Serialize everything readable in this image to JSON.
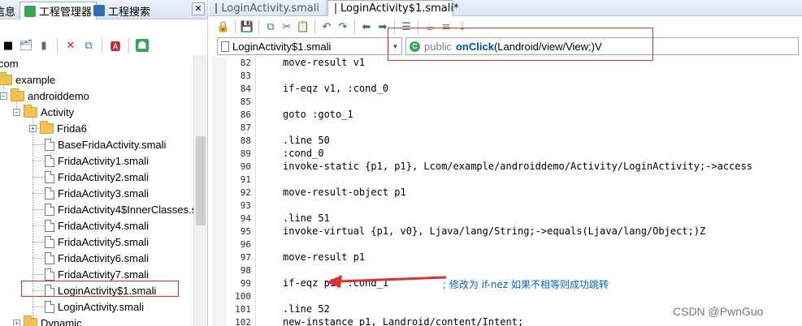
{
  "left_panel": {
    "tabs": [
      {
        "label": "信息"
      },
      {
        "label": "工程管理器"
      },
      {
        "label": "工程搜索"
      }
    ],
    "tree": [
      {
        "label": "com",
        "kind": "text"
      },
      {
        "label": "example",
        "kind": "folder"
      },
      {
        "label": "androiddemo",
        "kind": "folder"
      },
      {
        "label": "Activity",
        "kind": "folder"
      },
      {
        "label": "Frida6",
        "kind": "folder"
      },
      {
        "label": "BaseFridaActivity.smali",
        "kind": "file"
      },
      {
        "label": "FridaActivity1.smali",
        "kind": "file"
      },
      {
        "label": "FridaActivity2.smali",
        "kind": "file"
      },
      {
        "label": "FridaActivity3.smali",
        "kind": "file"
      },
      {
        "label": "FridaActivity4$InnerClasses.s",
        "kind": "file"
      },
      {
        "label": "FridaActivity4.smali",
        "kind": "file"
      },
      {
        "label": "FridaActivity5.smali",
        "kind": "file"
      },
      {
        "label": "FridaActivity6.smali",
        "kind": "file"
      },
      {
        "label": "FridaActivity7.smali",
        "kind": "file"
      },
      {
        "label": "LoginActivity$1.smali",
        "kind": "file"
      },
      {
        "label": "LoginActivity.smali",
        "kind": "file"
      },
      {
        "label": "Dynamic",
        "kind": "folder"
      }
    ]
  },
  "editor": {
    "tabs": [
      {
        "label": "LoginActivity.smali"
      },
      {
        "label": "LoginActivity$1.smali*"
      }
    ],
    "class_combo": "LoginActivity$1.smali",
    "method_combo": {
      "modifier": "public",
      "name": "onClick",
      "signature": "(Landroid/view/View;)V"
    },
    "lines": [
      {
        "n": "82",
        "code": "move-result v1"
      },
      {
        "n": "83",
        "code": ""
      },
      {
        "n": "84",
        "code": "if-eqz v1, :cond_0"
      },
      {
        "n": "85",
        "code": ""
      },
      {
        "n": "86",
        "code": "goto :goto_1"
      },
      {
        "n": "87",
        "code": ""
      },
      {
        "n": "88",
        "code": ".line 50"
      },
      {
        "n": "89",
        "code": ":cond_0"
      },
      {
        "n": "90",
        "code": "invoke-static {p1, p1}, Lcom/example/androiddemo/Activity/LoginActivity;->access"
      },
      {
        "n": "91",
        "code": ""
      },
      {
        "n": "92",
        "code": "move-result-object p1"
      },
      {
        "n": "93",
        "code": ""
      },
      {
        "n": "94",
        "code": ".line 51"
      },
      {
        "n": "95",
        "code": "invoke-virtual {p1, v0}, Ljava/lang/String;->equals(Ljava/lang/Object;)Z"
      },
      {
        "n": "96",
        "code": ""
      },
      {
        "n": "97",
        "code": "move-result p1"
      },
      {
        "n": "98",
        "code": ""
      },
      {
        "n": "99",
        "code": "if-eqz p1, :cond_1"
      },
      {
        "n": "100",
        "code": ""
      },
      {
        "n": "101",
        "code": ".line 52"
      },
      {
        "n": "102",
        "code": "new-instance p1, Landroid/content/Intent;"
      }
    ],
    "annotation": "; 修改为 if-nez 如果不相等则成功跳转"
  },
  "watermark": "CSDN @PwnGuo",
  "colors": {
    "highlight": "#e03030",
    "arrow": "#e03030",
    "keyword": "#000080",
    "comment": "#0066cc"
  }
}
